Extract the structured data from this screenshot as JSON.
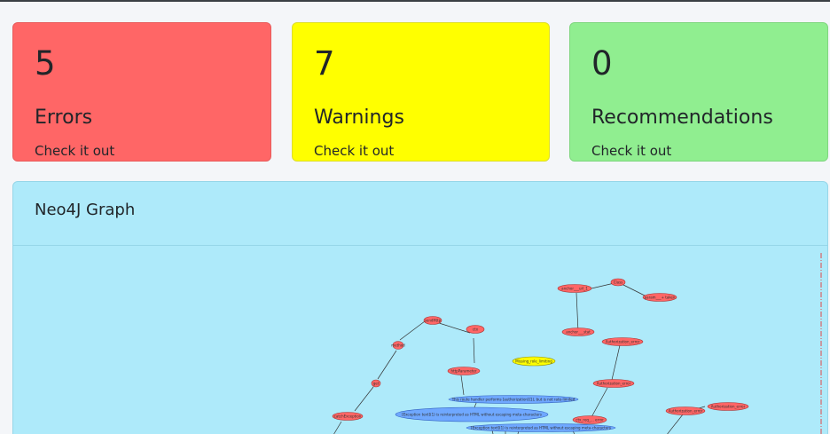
{
  "cards": {
    "errors": {
      "count": "5",
      "label": "Errors",
      "link": "Check it out",
      "color": "#ff6666"
    },
    "warnings": {
      "count": "7",
      "label": "Warnings",
      "link": "Check it out",
      "color": "#ffff00"
    },
    "recommendations": {
      "count": "0",
      "label": "Recommendations",
      "link": "Check it out",
      "color": "#90ee90"
    }
  },
  "graph": {
    "title": "Neo4J Graph",
    "background": "#aeeafa",
    "node_colors": {
      "error": "#ff6666",
      "warning": "#ffff00",
      "info": "#6fa8ff"
    },
    "nodes": [
      {
        "id": "n1",
        "type": "error",
        "label": "Class"
      },
      {
        "id": "n2",
        "type": "error",
        "label": "anchor___url_1"
      },
      {
        "id": "n3",
        "type": "error",
        "label": "param___+ taken"
      },
      {
        "id": "n4",
        "type": "error",
        "label": "anchor___stat"
      },
      {
        "id": "n5",
        "type": "error",
        "label": "Authorization_error"
      },
      {
        "id": "n6",
        "type": "error",
        "label": "sendHttp"
      },
      {
        "id": "n7",
        "type": "error",
        "label": "ctx"
      },
      {
        "id": "n8",
        "type": "error",
        "label": "method"
      },
      {
        "id": "n9",
        "type": "warning",
        "label": "Missing_role_limiting"
      },
      {
        "id": "n10",
        "type": "error",
        "label": "httpParameter"
      },
      {
        "id": "n11",
        "type": "error",
        "label": "Authorization_error"
      },
      {
        "id": "n12",
        "type": "error",
        "label": "get"
      },
      {
        "id": "n13",
        "type": "info",
        "label": "This route handler performs [authorization](1), but is not rate-limited"
      },
      {
        "id": "n14",
        "type": "info",
        "label": "[Exception text](1) is reinterpreted as HTML without escaping meta-characters"
      },
      {
        "id": "n15",
        "type": "error",
        "label": "catchException"
      },
      {
        "id": "n16",
        "type": "error",
        "label": "ctx_req_... error"
      },
      {
        "id": "n17",
        "type": "error",
        "label": "Authorization_error"
      },
      {
        "id": "n18",
        "type": "error",
        "label": "Authorization_error"
      },
      {
        "id": "n19",
        "type": "info",
        "label": "[Exception text](1) is reinterpreted as HTML without escaping meta-characters"
      }
    ]
  }
}
